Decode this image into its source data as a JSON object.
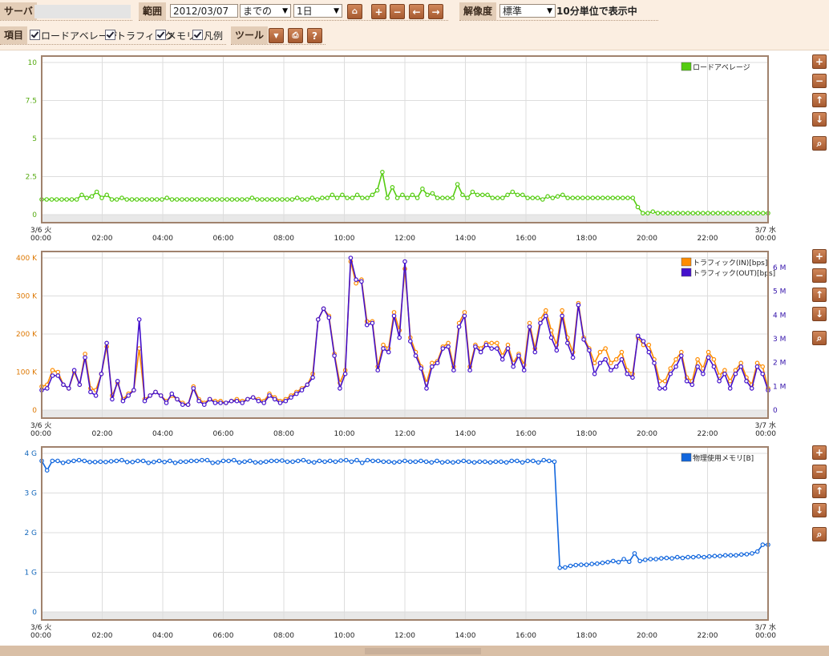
{
  "toolbar": {
    "server_label": "サーバ",
    "range_label": "範囲",
    "date_value": "2012/03/07",
    "until_value": "までの",
    "span_value": "1日",
    "resolution_label": "解像度",
    "resolution_value": "標準",
    "resolution_note": "10分単位で表示中",
    "items_label": "項目",
    "cb_load": "ロードアベレージ",
    "cb_traffic": "トラフィック",
    "cb_memory": "メモリ",
    "cb_legend": "凡例",
    "tools_label": "ツール",
    "icons": {
      "home": "home-icon",
      "plus": "plus-icon",
      "minus": "minus-icon",
      "left": "arrow-left-icon",
      "right": "arrow-right-icon",
      "dropdown": "chevron-down-icon",
      "print": "print-icon",
      "help": "help-icon"
    }
  },
  "side_icons": [
    "plus-icon",
    "minus-icon",
    "arrow-up-icon",
    "arrow-down-icon",
    "zoom-icon"
  ],
  "colors": {
    "load": "#55cc11",
    "traffic_in": "#ff8c00",
    "traffic_out": "#4411cc",
    "memory": "#1166dd",
    "frame": "#a0826d",
    "toolbar_bg": "#fbeee1",
    "label_bg": "#e3cdb7"
  },
  "chart_data": [
    {
      "type": "line",
      "x_tick_labels": [
        "3/6 火\n00:00",
        "02:00",
        "04:00",
        "06:00",
        "08:00",
        "10:00",
        "12:00",
        "14:00",
        "16:00",
        "18:00",
        "20:00",
        "22:00",
        "3/7 水\n00:00"
      ],
      "y_tick_labels": [
        "10",
        "7.5",
        "5",
        "2.5",
        "0"
      ],
      "ylim": [
        0,
        10
      ],
      "grid": true,
      "legend": "top-right",
      "series": [
        {
          "name": "ロードアベレージ",
          "color": "#55cc11",
          "values": [
            1.0,
            1.0,
            1.0,
            1.0,
            1.0,
            1.0,
            1.0,
            1.0,
            1.3,
            1.1,
            1.2,
            1.5,
            1.1,
            1.3,
            1.0,
            1.0,
            1.1,
            1.0,
            1.0,
            1.0,
            1.0,
            1.0,
            1.0,
            1.0,
            1.0,
            1.1,
            1.0,
            1.0,
            1.0,
            1.0,
            1.0,
            1.0,
            1.0,
            1.0,
            1.0,
            1.0,
            1.0,
            1.0,
            1.0,
            1.0,
            1.0,
            1.0,
            1.1,
            1.0,
            1.0,
            1.0,
            1.0,
            1.0,
            1.0,
            1.0,
            1.0,
            1.1,
            1.0,
            1.0,
            1.1,
            1.0,
            1.1,
            1.1,
            1.3,
            1.1,
            1.3,
            1.1,
            1.1,
            1.3,
            1.1,
            1.1,
            1.3,
            1.6,
            2.8,
            1.1,
            1.8,
            1.1,
            1.3,
            1.1,
            1.3,
            1.1,
            1.7,
            1.3,
            1.4,
            1.1,
            1.1,
            1.1,
            1.1,
            2.0,
            1.3,
            1.1,
            1.5,
            1.3,
            1.3,
            1.3,
            1.1,
            1.1,
            1.1,
            1.3,
            1.5,
            1.3,
            1.3,
            1.1,
            1.1,
            1.1,
            1.0,
            1.2,
            1.1,
            1.2,
            1.3,
            1.1,
            1.1,
            1.1,
            1.1,
            1.1,
            1.1,
            1.1,
            1.1,
            1.1,
            1.1,
            1.1,
            1.1,
            1.1,
            1.1,
            0.5,
            0.1,
            0.1,
            0.2,
            0.1,
            0.1,
            0.1,
            0.1,
            0.1,
            0.1,
            0.1,
            0.1,
            0.1,
            0.1,
            0.1,
            0.1,
            0.1,
            0.1,
            0.1,
            0.1,
            0.1,
            0.1,
            0.1,
            0.1,
            0.1,
            0.1,
            0.1
          ]
        }
      ]
    },
    {
      "type": "line",
      "x_tick_labels": [
        "3/6 火\n00:00",
        "02:00",
        "04:00",
        "06:00",
        "08:00",
        "10:00",
        "12:00",
        "14:00",
        "16:00",
        "18:00",
        "20:00",
        "22:00",
        "3/7 水\n00:00"
      ],
      "y_tick_labels": [
        "400 K",
        "300 K",
        "200 K",
        "100 K",
        "0"
      ],
      "y2_tick_labels": [
        "6 M",
        "5 M",
        "4 M",
        "3 M",
        "2 M",
        "1 M",
        "0"
      ],
      "ylim": [
        0,
        420
      ],
      "grid": true,
      "legend": "top-right",
      "series": [
        {
          "name": "トラフィック(IN)[bps]",
          "color": "#ff8c00",
          "values": [
            65,
            70,
            110,
            105,
            70,
            60,
            105,
            70,
            155,
            60,
            55,
            100,
            175,
            40,
            75,
            30,
            45,
            55,
            170,
            30,
            40,
            50,
            40,
            25,
            40,
            30,
            20,
            15,
            65,
            30,
            20,
            30,
            25,
            25,
            20,
            25,
            30,
            25,
            30,
            35,
            30,
            25,
            45,
            35,
            25,
            30,
            40,
            50,
            60,
            70,
            100,
            250,
            280,
            260,
            155,
            75,
            110,
            410,
            350,
            360,
            245,
            245,
            120,
            180,
            170,
            270,
            220,
            390,
            200,
            160,
            120,
            75,
            130,
            135,
            175,
            185,
            120,
            240,
            270,
            120,
            180,
            170,
            185,
            185,
            185,
            150,
            180,
            130,
            155,
            125,
            240,
            170,
            250,
            275,
            220,
            180,
            275,
            200,
            160,
            295,
            200,
            170,
            130,
            160,
            170,
            130,
            140,
            160,
            110,
            100,
            200,
            180,
            180,
            140,
            80,
            80,
            115,
            140,
            160,
            90,
            80,
            140,
            115,
            160,
            140,
            95,
            110,
            80,
            110,
            130,
            90,
            70,
            130,
            120,
            60
          ]
        },
        {
          "name": "トラフィック(OUT)[bps]",
          "color": "#4411cc",
          "values": [
            55,
            60,
            95,
            95,
            70,
            60,
            110,
            70,
            145,
            50,
            40,
            100,
            185,
            30,
            80,
            25,
            40,
            55,
            250,
            25,
            40,
            50,
            40,
            20,
            45,
            30,
            15,
            15,
            60,
            25,
            15,
            30,
            20,
            20,
            20,
            25,
            25,
            20,
            30,
            35,
            25,
            20,
            40,
            30,
            20,
            25,
            35,
            45,
            55,
            70,
            90,
            250,
            280,
            255,
            150,
            60,
            100,
            420,
            360,
            355,
            235,
            240,
            110,
            170,
            160,
            260,
            200,
            410,
            190,
            150,
            115,
            60,
            120,
            130,
            170,
            175,
            110,
            230,
            260,
            110,
            175,
            160,
            180,
            170,
            170,
            140,
            170,
            120,
            150,
            110,
            230,
            160,
            240,
            260,
            200,
            165,
            260,
            185,
            145,
            290,
            195,
            165,
            100,
            130,
            140,
            110,
            120,
            140,
            100,
            90,
            205,
            190,
            160,
            130,
            60,
            60,
            100,
            120,
            150,
            80,
            70,
            120,
            100,
            145,
            120,
            80,
            100,
            60,
            100,
            120,
            80,
            60,
            120,
            100,
            55
          ]
        }
      ]
    },
    {
      "type": "line",
      "x_tick_labels": [
        "3/6 火\n00:00",
        "02:00",
        "04:00",
        "06:00",
        "08:00",
        "10:00",
        "12:00",
        "14:00",
        "16:00",
        "18:00",
        "20:00",
        "22:00",
        "3/7 水\n00:00"
      ],
      "y_tick_labels": [
        "4 G",
        "3 G",
        "2 G",
        "1 G",
        "0"
      ],
      "ylim": [
        0,
        4.2
      ],
      "grid": true,
      "legend": "top-right",
      "series": [
        {
          "name": "物理使用メモリ[B]",
          "color": "#1166dd",
          "values": [
            4.0,
            3.75,
            4.0,
            4.0,
            3.95,
            3.98,
            4.0,
            4.02,
            4.0,
            3.97,
            3.97,
            3.98,
            3.97,
            3.99,
            4.0,
            4.02,
            3.97,
            3.97,
            4.0,
            4.0,
            3.95,
            3.97,
            4.0,
            3.97,
            4.0,
            3.95,
            3.98,
            3.98,
            4.0,
            4.0,
            4.02,
            4.02,
            3.95,
            3.96,
            4.0,
            4.0,
            4.02,
            3.96,
            3.98,
            4.0,
            3.96,
            3.96,
            3.98,
            4.0,
            4.0,
            4.01,
            3.98,
            3.98,
            4.0,
            4.02,
            3.98,
            3.96,
            4.0,
            3.98,
            4.0,
            3.98,
            4.01,
            4.02,
            3.98,
            4.02,
            3.95,
            4.02,
            4.0,
            4.0,
            3.98,
            3.98,
            3.96,
            3.98,
            4.0,
            3.98,
            3.98,
            4.0,
            3.98,
            3.96,
            4.0,
            3.96,
            3.98,
            3.96,
            3.98,
            4.0,
            3.98,
            3.96,
            3.98,
            3.98,
            3.96,
            3.98,
            3.98,
            3.96,
            4.0,
            4.0,
            3.96,
            4.0,
            4.0,
            3.96,
            4.02,
            4.0,
            3.98,
            1.17,
            1.18,
            1.22,
            1.24,
            1.25,
            1.25,
            1.27,
            1.28,
            1.3,
            1.32,
            1.35,
            1.32,
            1.4,
            1.33,
            1.55,
            1.35,
            1.38,
            1.4,
            1.4,
            1.42,
            1.43,
            1.42,
            1.45,
            1.43,
            1.45,
            1.45,
            1.47,
            1.45,
            1.47,
            1.48,
            1.48,
            1.5,
            1.5,
            1.5,
            1.52,
            1.53,
            1.55,
            1.6,
            1.78,
            1.78
          ]
        }
      ]
    }
  ]
}
